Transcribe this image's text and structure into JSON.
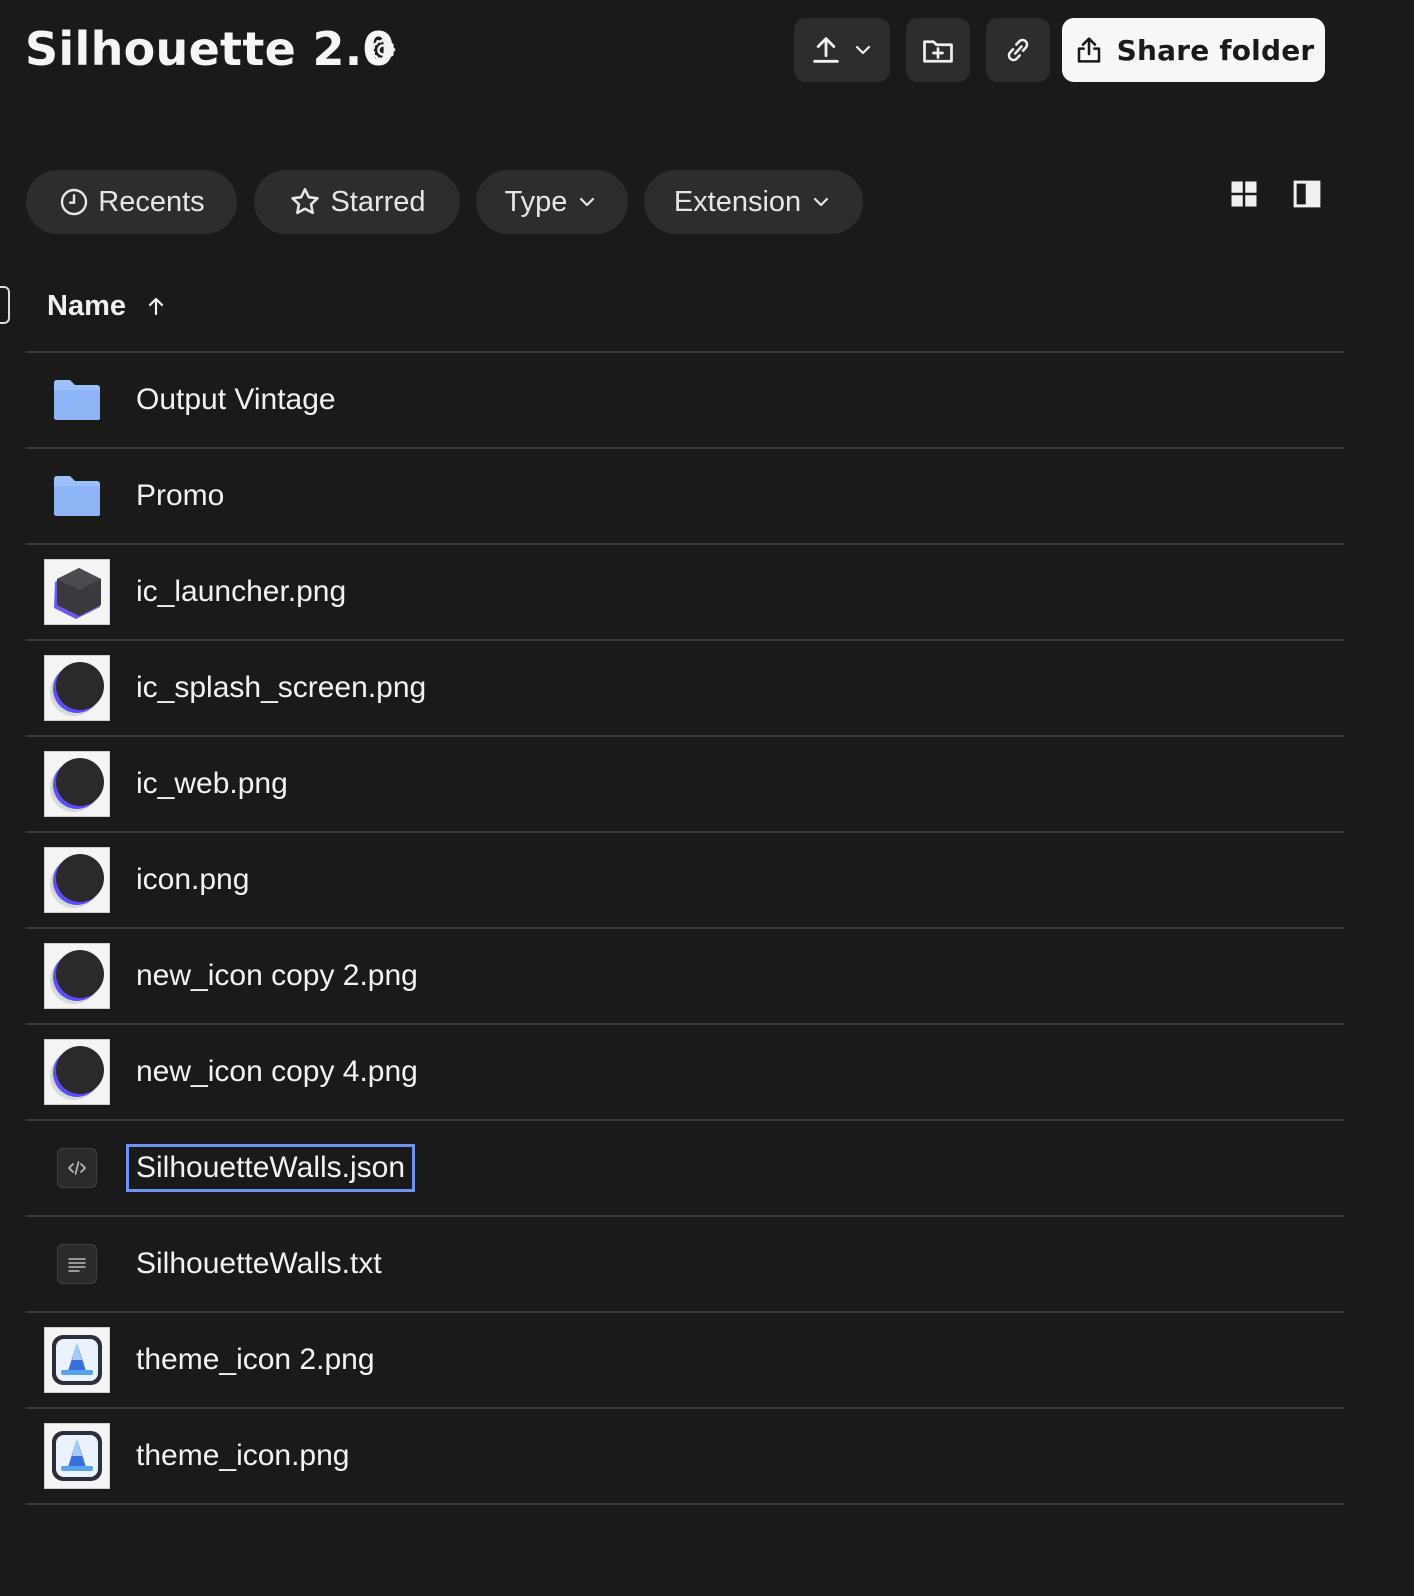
{
  "header": {
    "title": "Silhouette 2.0",
    "share_label": "Share folder"
  },
  "filters": {
    "recents": "Recents",
    "starred": "Starred",
    "type": "Type",
    "extension": "Extension"
  },
  "table": {
    "name_header": "Name",
    "sort": "ascending"
  },
  "files": [
    {
      "name": "Output Vintage",
      "kind": "folder"
    },
    {
      "name": "Promo",
      "kind": "folder"
    },
    {
      "name": "ic_launcher.png",
      "kind": "image-hexagon"
    },
    {
      "name": "ic_splash_screen.png",
      "kind": "image-circle"
    },
    {
      "name": "ic_web.png",
      "kind": "image-circle"
    },
    {
      "name": "icon.png",
      "kind": "image-circle"
    },
    {
      "name": "new_icon copy 2.png",
      "kind": "image-circle"
    },
    {
      "name": "new_icon copy 4.png",
      "kind": "image-circle"
    },
    {
      "name": "SilhouetteWalls.json",
      "kind": "code",
      "selected": true
    },
    {
      "name": "SilhouetteWalls.txt",
      "kind": "text"
    },
    {
      "name": "theme_icon 2.png",
      "kind": "image-theme"
    },
    {
      "name": "theme_icon.png",
      "kind": "image-theme"
    }
  ],
  "colors": {
    "background": "#1a1a1a",
    "button_bg": "#2d2d2d",
    "folder": "#8fb4f5",
    "selection": "#6f93ee",
    "accent_purple": "#5b4ff0"
  }
}
